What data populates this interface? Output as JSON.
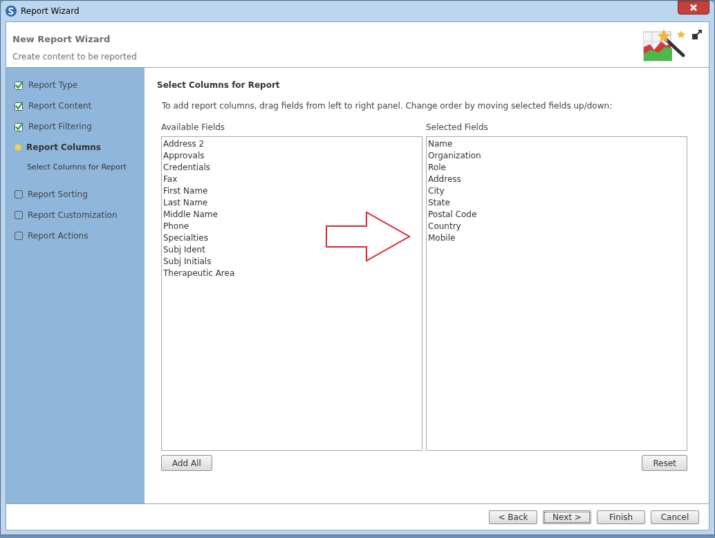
{
  "window": {
    "title": "Report Wizard"
  },
  "header": {
    "title": "New Report Wizard",
    "subtitle": "Create content to be reported"
  },
  "steps": [
    {
      "label": "Report Type",
      "kind": "done"
    },
    {
      "label": "Report Content",
      "kind": "done"
    },
    {
      "label": "Report Filtering",
      "kind": "done"
    },
    {
      "label": "Report Columns",
      "kind": "current",
      "children": [
        {
          "label": "Select Columns for Report"
        }
      ]
    },
    {
      "label": "Report Sorting",
      "kind": "pending"
    },
    {
      "label": "Report Customization",
      "kind": "pending"
    },
    {
      "label": "Report Actions",
      "kind": "pending"
    }
  ],
  "content": {
    "title": "Select Columns for Report",
    "instructions": "To add report columns, drag fields from left to right panel. Change order by moving selected fields up/down:",
    "available": {
      "label": "Available Fields",
      "items": [
        "Address 2",
        "Approvals",
        "Credentials",
        "Fax",
        "First Name",
        "Last Name",
        "Middle Name",
        "Phone",
        "Specialties",
        "Subj Ident",
        "Subj Initials",
        "Therapeutic Area"
      ],
      "button": "Add All"
    },
    "selected": {
      "label": "Selected Fields",
      "items": [
        "Name",
        "Organization",
        "Role",
        "Address",
        "City",
        "State",
        "Postal Code",
        "Country",
        "Mobile"
      ],
      "button": "Reset"
    }
  },
  "buttons": [
    {
      "label": "< Back",
      "focused": false
    },
    {
      "label": "Next >",
      "focused": true
    },
    {
      "label": "Finish",
      "focused": false
    },
    {
      "label": "Cancel",
      "focused": false
    }
  ]
}
